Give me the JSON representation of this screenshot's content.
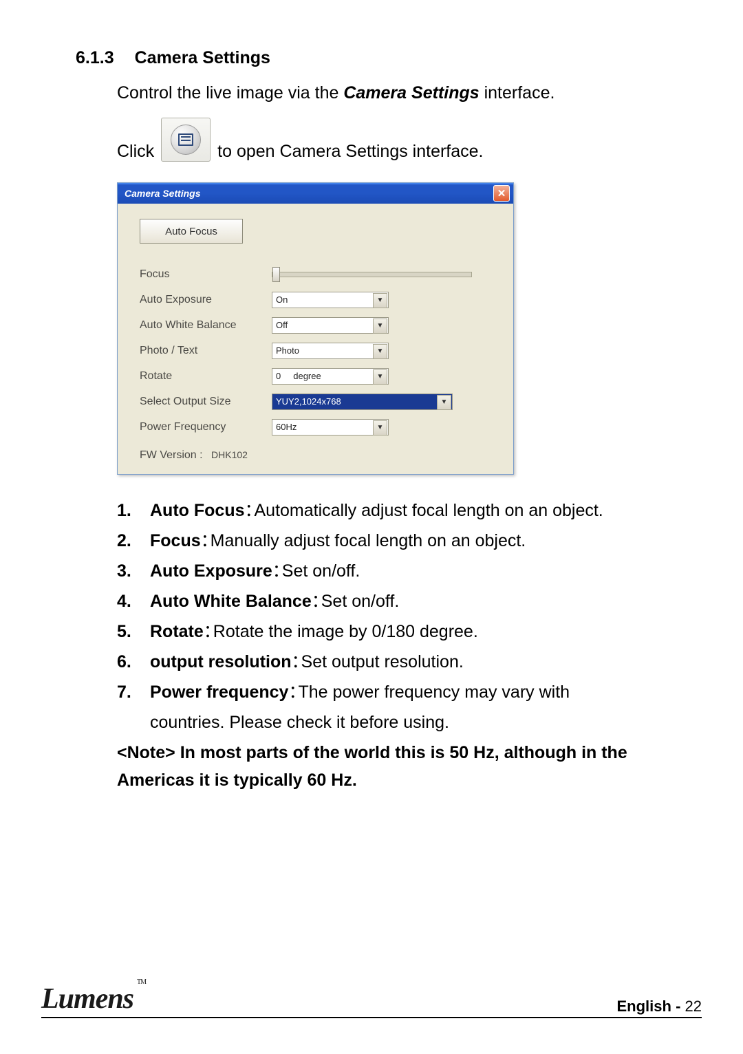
{
  "section": {
    "number": "6.1.3",
    "title": "Camera Settings"
  },
  "intro": {
    "pre": "Control the live image via the ",
    "bold": "Camera Settings",
    "post": " interface."
  },
  "click": {
    "pre": "Click",
    "post": "to open Camera Settings interface."
  },
  "dialog": {
    "title": "Camera Settings",
    "auto_focus_btn": "Auto Focus",
    "labels": {
      "focus": "Focus",
      "auto_exposure": "Auto Exposure",
      "auto_white_balance": "Auto White Balance",
      "photo_text": "Photo / Text",
      "rotate": "Rotate",
      "output_size": "Select Output Size",
      "power_freq": "Power Frequency",
      "fw_version": "FW Version :"
    },
    "values": {
      "auto_exposure": "On",
      "auto_white_balance": "Off",
      "photo_text": "Photo",
      "rotate_num": "0",
      "rotate_unit": "degree",
      "output_size": "YUY2,1024x768",
      "power_freq": "60Hz",
      "fw_version": "DHK102"
    }
  },
  "items": [
    {
      "n": "1.",
      "term": "Auto Focus",
      "sep": "：",
      "desc": "Automatically adjust focal length on an object."
    },
    {
      "n": "2.",
      "term": "Focus",
      "sep": "：",
      "desc": "Manually adjust focal length on an object."
    },
    {
      "n": "3.",
      "term": "Auto Exposure",
      "sep": "：",
      "desc": "Set on/off."
    },
    {
      "n": "4.",
      "term": "Auto White Balance",
      "sep": "：",
      "desc": "Set on/off."
    },
    {
      "n": "5.",
      "term": "Rotate",
      "sep": "：",
      "desc": "Rotate the image by 0/180 degree."
    },
    {
      "n": "6.",
      "term": "output resolution",
      "sep": "：",
      "desc": "Set output resolution."
    },
    {
      "n": "7.",
      "term": "Power frequency",
      "sep": "：",
      "desc": "The power frequency may vary with",
      "cont": "countries. Please check it before using."
    }
  ],
  "note": "<Note> In most parts of the world this is 50 Hz, although in the Americas it is typically 60 Hz.",
  "footer": {
    "logo": "Lumens",
    "tm": "TM",
    "lang": "English",
    "dash": " - ",
    "page": "22"
  }
}
